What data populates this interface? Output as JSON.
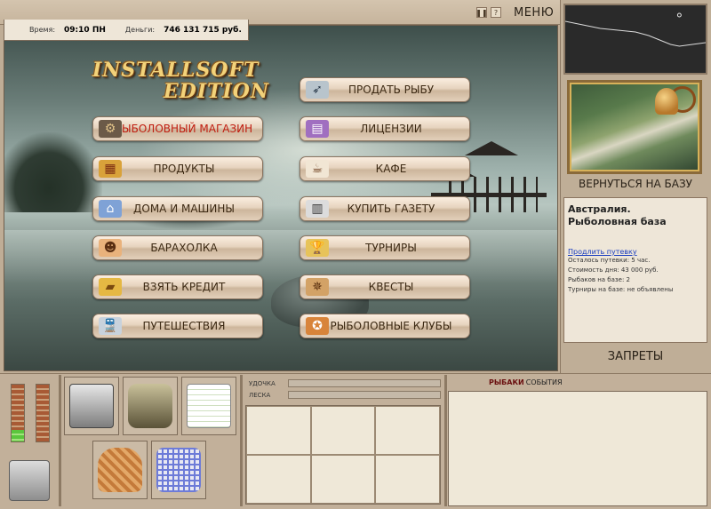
{
  "stats": {
    "time_label": "Время:",
    "time_value": "09:10 ПН",
    "money_label": "Деньги:",
    "money_value": "746 131 715 руб."
  },
  "top": {
    "pause_icon": "pause-icon",
    "help_label": "?",
    "menu_label": "МЕНЮ"
  },
  "logo": {
    "line1": "INSTALLSOFT",
    "line2": "EDITION"
  },
  "menu_left": [
    {
      "label": "РЫБОЛОВНЫЙ МАГАЗИН",
      "icon": "boat-motor-icon",
      "highlight": true
    },
    {
      "label": "ПРОДУКТЫ",
      "icon": "groceries-icon"
    },
    {
      "label": "ДОМА И МАШИНЫ",
      "icon": "house-icon"
    },
    {
      "label": "БАРАХОЛКА",
      "icon": "people-icon"
    },
    {
      "label": "ВЗЯТЬ КРЕДИТ",
      "icon": "gold-bars-icon"
    },
    {
      "label": "ПУТЕШЕСТВИЯ",
      "icon": "train-icon"
    }
  ],
  "menu_right": [
    {
      "label": "ПРОДАТЬ РЫБУ",
      "icon": "fish-icon"
    },
    {
      "label": "ЛИЦЕНЗИИ",
      "icon": "license-icon"
    },
    {
      "label": "КАФЕ",
      "icon": "coffee-cup-icon"
    },
    {
      "label": "КУПИТЬ ГАЗЕТУ",
      "icon": "newspaper-icon"
    },
    {
      "label": "ТУРНИРЫ",
      "icon": "trophy-icon"
    },
    {
      "label": "КВЕСТЫ",
      "icon": "compass-icon"
    },
    {
      "label": "РЫБОЛОВНЫЕ КЛУБЫ",
      "icon": "club-emblem-icon"
    }
  ],
  "right": {
    "return_label": "ВЕРНУТЬСЯ НА БАЗУ",
    "base_title": "Австралия. Рыболовная база",
    "extend_link": "Продлить путевку",
    "info_rows": [
      "Осталось путевки: 5 час.",
      "Стоимость дня: 43 000 руб.",
      "Рыбаков на базе: 2",
      "Турниры на базе: не объявлены"
    ],
    "bans_label": "ЗАПРЕТЫ"
  },
  "bottom": {
    "rod_label": "УДОЧКА",
    "line_label": "ЛЕСКА",
    "rod_level": 0,
    "line_level": 0,
    "gauge_left_level": 0.2,
    "gauge_right_level": 0,
    "tabs": [
      "РЫБАКИ",
      "СОБЫТИЯ"
    ]
  },
  "colors": {
    "accent_red": "#c01d10",
    "button_text": "#3d2a14"
  }
}
